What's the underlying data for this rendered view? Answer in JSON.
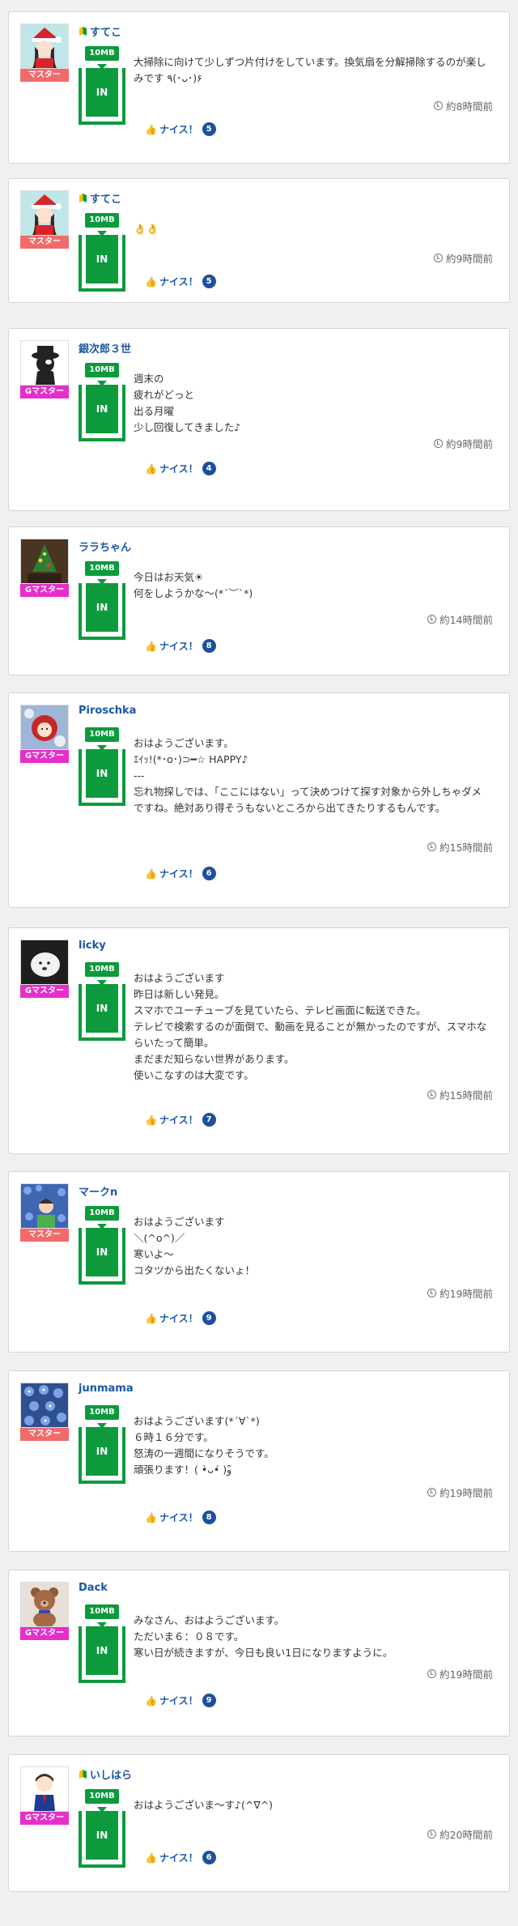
{
  "labels": {
    "nice": "ナイス！",
    "bin_in": "IN"
  },
  "colors": {
    "green": "#0c9a3d",
    "link": "#1b57a8",
    "badge_master": "#f26b6b",
    "badge_gmaster": "#e62ecb"
  },
  "posts": [
    {
      "user": "すてこ",
      "beginner": true,
      "badge": "マスター",
      "badge_type": "m",
      "avatar": "santa-girl",
      "size": "10MB",
      "text": "大掃除に向けて少しずつ片付けをしています。換気扇を分解掃除するのが楽しみです ٩(･ᴗ･)۶",
      "time": "約8時間前",
      "nice_count": "5"
    },
    {
      "user": "すてこ",
      "beginner": true,
      "badge": "マスター",
      "badge_type": "m",
      "avatar": "santa-girl",
      "size": "10MB",
      "text": "👌👌",
      "time": "約9時間前",
      "nice_count": "5"
    },
    {
      "user": "銀次郎３世",
      "beginner": false,
      "badge": "Gマスター",
      "badge_type": "g",
      "avatar": "black-cat",
      "size": "10MB",
      "text": "週末の\n疲れがどっと\n出る月曜\n少し回復してきました♪",
      "time": "約9時間前",
      "nice_count": "4"
    },
    {
      "user": "ララちゃん",
      "beginner": false,
      "badge": "Gマスター",
      "badge_type": "g",
      "avatar": "christmas-tree",
      "size": "10MB",
      "text": "今日はお天気☀\n何をしようかな〜(*´︶`*)",
      "time": "約14時間前",
      "nice_count": "8"
    },
    {
      "user": "Piroschka",
      "beginner": false,
      "badge": "Gマスター",
      "badge_type": "g",
      "avatar": "red-hood",
      "size": "10MB",
      "text": "おはようございます。\nｴｲｯ!(*･ο･)⊃━☆ HAPPY♪\n---\n忘れ物探しでは、「ここにはない」って決めつけて探す対象から外しちゃダメですね。絶対あり得そうもないところから出てきたりするもんです。",
      "time": "約15時間前",
      "nice_count": "6"
    },
    {
      "user": "licky",
      "beginner": false,
      "badge": "Gマスター",
      "badge_type": "g",
      "avatar": "white-dog",
      "size": "10MB",
      "text": "おはようございます\n昨日は新しい発見。\nスマホでユーチューブを見ていたら、テレビ画面に転送できた。\nテレビで検索するのが面倒で、動画を見ることが無かったのですが、スマホならいたって簡単。\nまだまだ知らない世界があります。\n使いこなすのは大変です。",
      "time": "約15時間前",
      "nice_count": "7"
    },
    {
      "user": "マークn",
      "beginner": false,
      "badge": "マスター",
      "badge_type": "m",
      "avatar": "flowers-man",
      "size": "10MB",
      "text": "おはようございます\n＼(^o^)／\n寒いよ〜\nコタツから出たくないょ！",
      "time": "約19時間前",
      "nice_count": "9"
    },
    {
      "user": "junmama",
      "beginner": false,
      "badge": "マスター",
      "badge_type": "m",
      "avatar": "blue-flowers",
      "size": "10MB",
      "text": "おはようございます(*´∀`*)\n６時１６分です。\n怒涛の一週間になりそうです。\n頑張ります！( •̀ᴗ•́ )و ̑̑",
      "time": "約19時間前",
      "nice_count": "8"
    },
    {
      "user": "Dack",
      "beginner": false,
      "badge": "Gマスター",
      "badge_type": "g",
      "avatar": "teddy-bear",
      "size": "10MB",
      "text": "みなさん、おはようございます。\nただいま６：０８です。\n寒い日が続きますが、今日も良い1日になりますように。",
      "time": "約19時間前",
      "nice_count": "9"
    },
    {
      "user": "いしはら",
      "beginner": true,
      "badge": "Gマスター",
      "badge_type": "g",
      "avatar": "boy-suit",
      "size": "10MB",
      "text": "おはようございま〜す♪(^∇^)",
      "time": "約20時間前",
      "nice_count": "6"
    }
  ]
}
